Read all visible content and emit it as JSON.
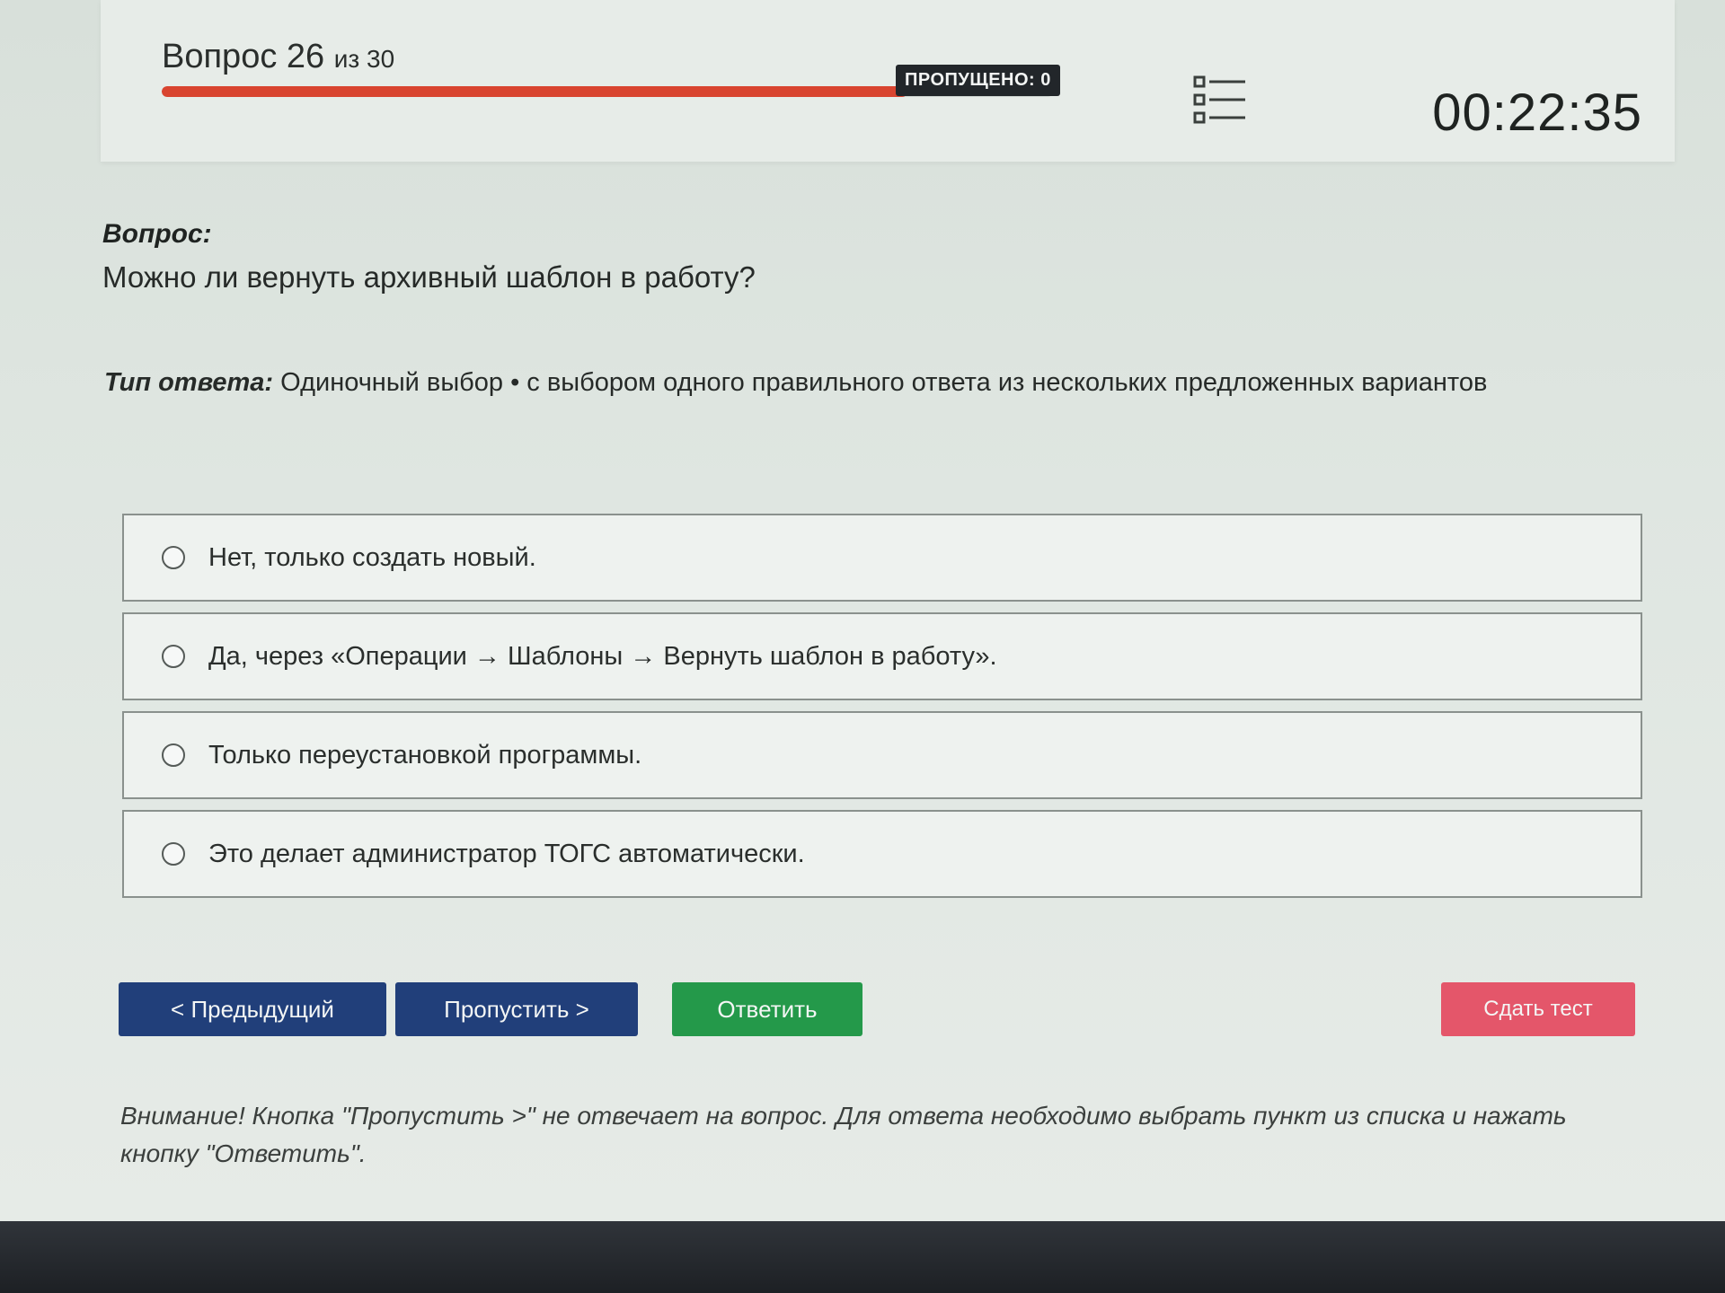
{
  "header": {
    "question_prefix": "Вопрос",
    "question_current": "26",
    "question_of": "из 30",
    "progress_fraction": 0.837,
    "skipped_label": "ПРОПУЩЕНО: 0",
    "list_icon": "question-list-icon",
    "timer": "00:22:35"
  },
  "question": {
    "label": "Вопрос:",
    "text": "Можно ли вернуть архивный шаблон в работу?"
  },
  "answer_type": {
    "label": "Тип ответа:",
    "value": "Одиночный выбор • с выбором одного правильного ответа из нескольких предложенных вариантов"
  },
  "options": [
    {
      "text": "Нет, только создать новый."
    },
    {
      "text": "Да, через «Операции → Шаблоны → Вернуть шаблон в работу»."
    },
    {
      "text": "Только переустановкой программы."
    },
    {
      "text": "Это делает администратор ТОГС автоматически."
    }
  ],
  "buttons": {
    "prev": "< Предыдущий",
    "skip": "Пропустить >",
    "answer": "Ответить",
    "submit": "Сдать тест"
  },
  "colors": {
    "progress": "#d9442f",
    "nav_button": "#213f7a",
    "answer_button": "#24994a",
    "submit_button": "#e4566a"
  },
  "warning": "Внимание! Кнопка \"Пропустить >\" не отвечает на вопрос. Для ответа необходимо выбрать пункт из списка и нажать кнопку \"Ответить\"."
}
